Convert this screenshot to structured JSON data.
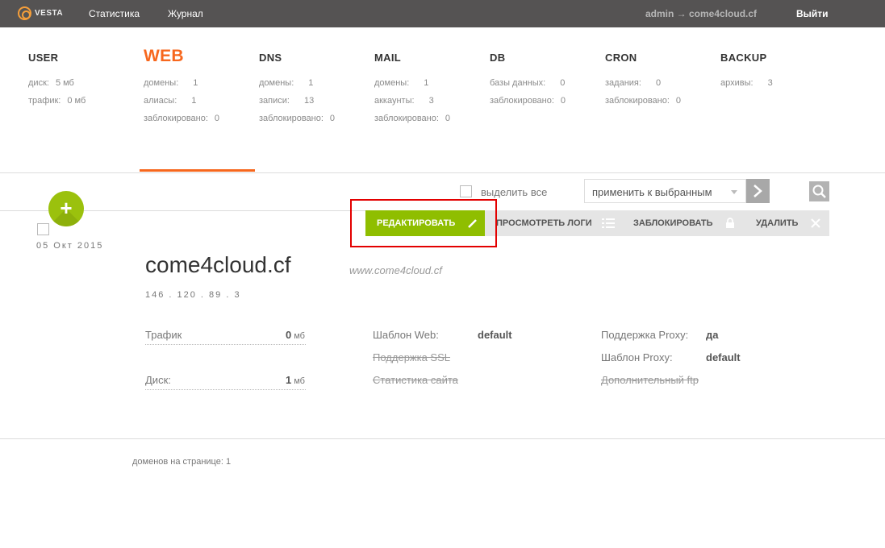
{
  "topbar": {
    "logo_text": "VESTA",
    "nav": [
      "Статистика",
      "Журнал"
    ],
    "user_path": "admin → come4cloud.cf",
    "logout": "Выйти"
  },
  "stats": [
    {
      "title": "USER",
      "active": false,
      "rows": [
        {
          "label": "диск:",
          "value": "5 мб"
        },
        {
          "label": "трафик:",
          "value": "0 мб"
        }
      ]
    },
    {
      "title": "WEB",
      "active": true,
      "rows": [
        {
          "label": "домены:",
          "value": "1"
        },
        {
          "label": "алиасы:",
          "value": "1"
        },
        {
          "label": "заблокировано:",
          "value": "0"
        }
      ]
    },
    {
      "title": "DNS",
      "active": false,
      "rows": [
        {
          "label": "домены:",
          "value": "1"
        },
        {
          "label": "записи:",
          "value": "13"
        },
        {
          "label": "заблокировано:",
          "value": "0"
        }
      ]
    },
    {
      "title": "MAIL",
      "active": false,
      "rows": [
        {
          "label": "домены:",
          "value": "1"
        },
        {
          "label": "аккаунты:",
          "value": "3"
        },
        {
          "label": "заблокировано:",
          "value": "0"
        }
      ]
    },
    {
      "title": "DB",
      "active": false,
      "rows": [
        {
          "label": "базы данных:",
          "value": "0"
        },
        {
          "label": "заблокировано:",
          "value": "0"
        }
      ]
    },
    {
      "title": "CRON",
      "active": false,
      "rows": [
        {
          "label": "задания:",
          "value": "0"
        },
        {
          "label": "заблокировано:",
          "value": "0"
        }
      ]
    },
    {
      "title": "BACKUP",
      "active": false,
      "rows": [
        {
          "label": "архивы:",
          "value": "3"
        }
      ]
    }
  ],
  "toolbar": {
    "select_all": "выделить все",
    "apply_selected": "применить к выбранным"
  },
  "item": {
    "date": "05 Окт 2015",
    "actions": {
      "edit": "РЕДАКТИРОВАТЬ",
      "logs": "ПРОСМОТРЕТЬ ЛОГИ",
      "suspend": "ЗАБЛОКИРОВАТЬ",
      "delete": "УДАЛИТЬ"
    },
    "domain": "come4cloud.cf",
    "alias": "www.come4cloud.cf",
    "ip": "146 . 120 . 89 . 3",
    "traffic_label": "Трафик",
    "traffic_value": "0",
    "traffic_unit": "мб",
    "disk_label": "Диск:",
    "disk_value": "1",
    "disk_unit": "мб",
    "web_template_label": "Шаблон Web:",
    "web_template_value": "default",
    "ssl_support": "Поддержка SSL",
    "site_stats": "Статистика сайта",
    "proxy_support_label": "Поддержка Proxy:",
    "proxy_support_value": "да",
    "proxy_template_label": "Шаблон Proxy:",
    "proxy_template_value": "default",
    "extra_ftp": "Дополнительный ftp"
  },
  "footer": {
    "per_page": "доменов на странице: 1"
  }
}
